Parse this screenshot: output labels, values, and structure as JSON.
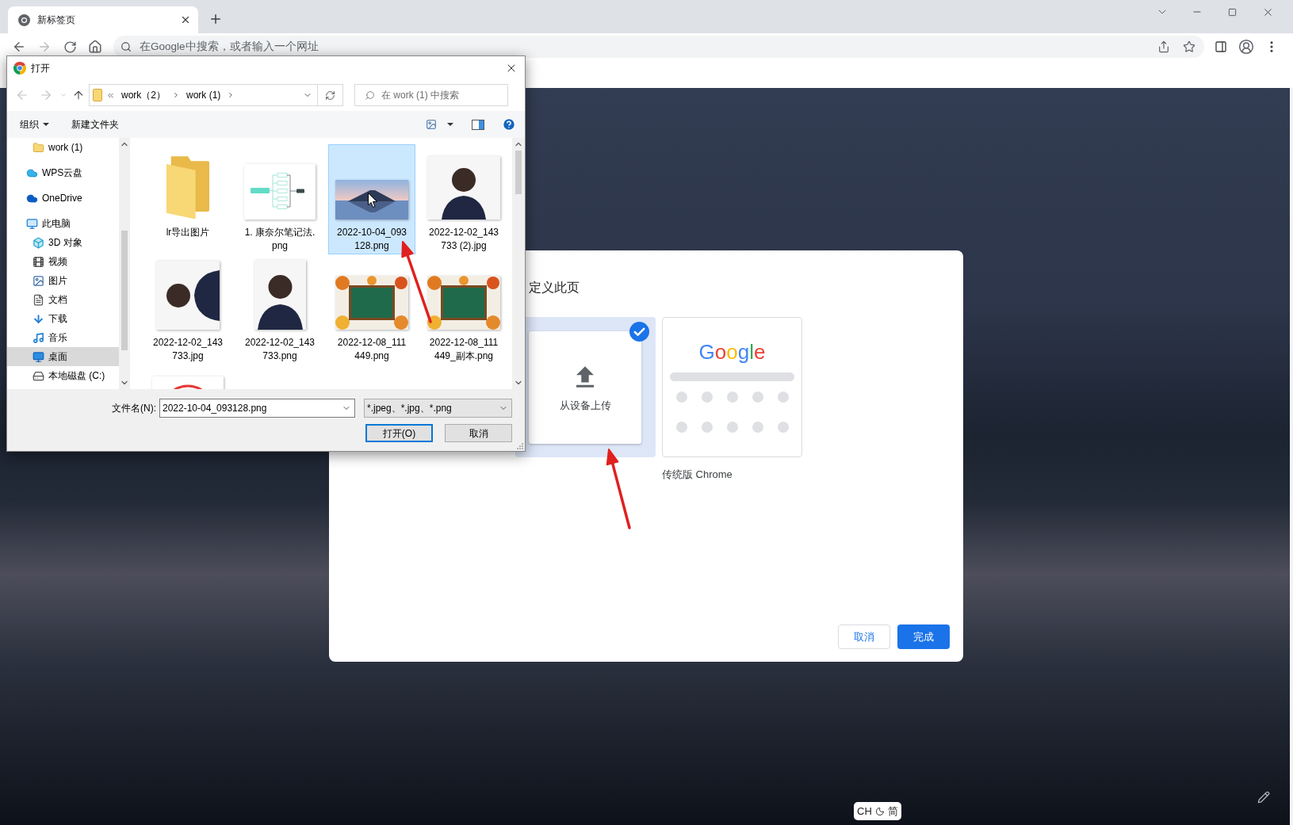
{
  "browser": {
    "tab": {
      "title": "新标签页"
    },
    "omnibox": {
      "placeholder": "在Google中搜索，或者输入一个网址"
    }
  },
  "customize_dialog": {
    "title": "定义此页",
    "options": [
      {
        "kind": "upload",
        "label": "从设备上传",
        "selected": true
      },
      {
        "kind": "classic",
        "logo": "Google",
        "caption": "传统版 Chrome",
        "selected": false
      }
    ],
    "buttons": [
      {
        "kind": "secondary",
        "label": "取消"
      },
      {
        "kind": "primary",
        "label": "完成"
      }
    ]
  },
  "file_dialog": {
    "title": "打开",
    "path": [
      "work（2）",
      "work (1)"
    ],
    "search": {
      "placeholder": "在 work (1) 中搜索"
    },
    "toolbar": [
      {
        "label": "组织",
        "menu": true
      },
      {
        "label": "新建文件夹",
        "menu": false
      }
    ],
    "nav_pane": {
      "continued_items": [
        {
          "kind": "folder",
          "label": "work (1)",
          "selected": false
        }
      ],
      "items": [
        {
          "kind": "cloud",
          "label": "WPS云盘",
          "selected": false
        },
        {
          "kind": "onedrive",
          "label": "OneDrive",
          "selected": false
        },
        {
          "kind": "computer",
          "label": "此电脑",
          "selected": false,
          "children": [
            {
              "kind": "cube",
              "label": "3D 对象",
              "selected": false
            },
            {
              "kind": "video",
              "label": "视频",
              "selected": false
            },
            {
              "kind": "pictures",
              "label": "图片",
              "selected": false
            },
            {
              "kind": "documents",
              "label": "文档",
              "selected": false
            },
            {
              "kind": "downloads",
              "label": "下载",
              "selected": false
            },
            {
              "kind": "music",
              "label": "音乐",
              "selected": false
            },
            {
              "kind": "desktop",
              "label": "桌面",
              "selected": true
            },
            {
              "kind": "drive",
              "label": "本地磁盘 (C:)",
              "selected": false
            }
          ]
        }
      ]
    },
    "files": [
      {
        "kind": "folder",
        "name": "lr导出图片",
        "selected": false
      },
      {
        "kind": "diagram",
        "name": "1. 康奈尔笔记法.\npng",
        "selected": false
      },
      {
        "kind": "landscape",
        "name": "2022-10-04_093\n128.png",
        "selected": true
      },
      {
        "kind": "headshot",
        "name": "2022-12-02_143\n733 (2).jpg",
        "selected": false
      },
      {
        "kind": "sideways",
        "name": "2022-12-02_143\n733.jpg",
        "selected": false
      },
      {
        "kind": "portrait",
        "name": "2022-12-02_143\n733.png",
        "selected": false
      },
      {
        "kind": "chalkboard",
        "name": "2022-12-08_111\n449.png",
        "selected": false
      },
      {
        "kind": "chalkboard",
        "name": "2022-12-08_111\n449_副本.png",
        "selected": false
      },
      {
        "kind": "stamp",
        "selected": false
      }
    ],
    "filename": {
      "label": "文件名(N):",
      "value": "2022-10-04_093128.png"
    },
    "file_type": {
      "value": "*.jpeg、*.jpg、*.png"
    },
    "buttons": [
      {
        "kind": "default",
        "label": "打开(O)"
      },
      {
        "kind": "normal",
        "label": "取消"
      }
    ]
  },
  "ime_indicator": {
    "language": "CH",
    "mode": "简"
  }
}
